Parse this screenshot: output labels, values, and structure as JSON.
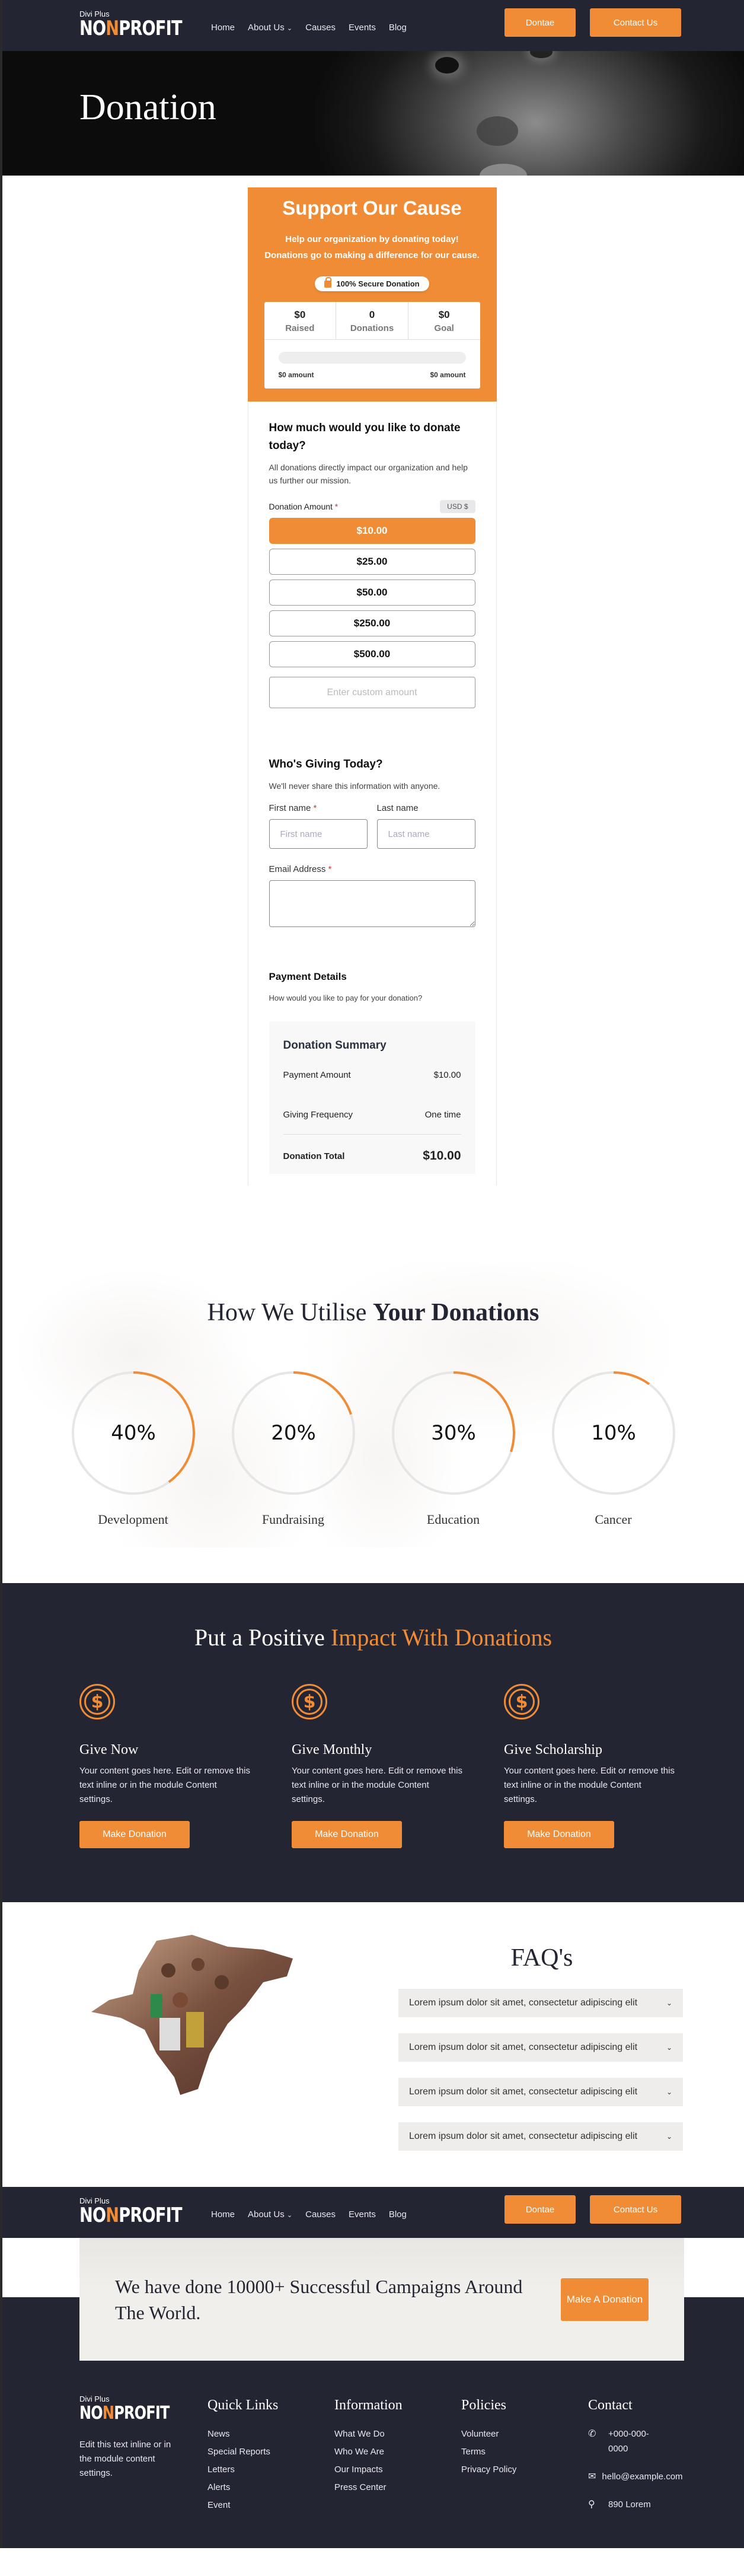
{
  "brand": {
    "sub": "Divi Plus",
    "main_pre": "NO",
    "main_hl": "N",
    "main_post": "PROFIT",
    "accent": "#f08c35",
    "dark": "#232532"
  },
  "nav": {
    "items": [
      "Home",
      "About Us",
      "Causes",
      "Events",
      "Blog"
    ],
    "dropdown_icon": "chevron-down-icon",
    "donate_label": "Dontae",
    "contact_label": "Contact Us"
  },
  "hero": {
    "title": "Donation"
  },
  "cause": {
    "title": "Support Our Cause",
    "text": "Help our organization by donating today! Donations go to making a difference for our cause.",
    "secure_label": "100% Secure Donation",
    "stats": [
      {
        "value": "$0",
        "label": "Raised"
      },
      {
        "value": "0",
        "label": "Donations"
      },
      {
        "value": "$0",
        "label": "Goal"
      }
    ],
    "progress_percent": 0,
    "progress_left": "$0 amount",
    "progress_right": "$0 amount"
  },
  "amount_section": {
    "title": "How much would you like to donate today?",
    "desc": "All donations directly impact our organization and help us further our mission.",
    "label": "Donation Amount",
    "required": "*",
    "currency": "USD  $",
    "options": [
      "$10.00",
      "$25.00",
      "$50.00",
      "$250.00",
      "$500.00"
    ],
    "selected_index": 0,
    "custom_placeholder": "Enter custom amount"
  },
  "giver_section": {
    "title": "Who's Giving Today?",
    "desc": "We'll never share this information with anyone.",
    "first_label": "First name",
    "first_placeholder": "First name",
    "last_label": "Last name",
    "last_placeholder": "Last name",
    "email_label": "Email Address",
    "required": "*"
  },
  "payment_section": {
    "title": "Payment Details",
    "desc": "How would you like to pay for your donation?",
    "summary_title": "Donation Summary",
    "rows": [
      {
        "label": "Payment Amount",
        "value": "$10.00"
      },
      {
        "label": "Giving Frequency",
        "value": "One time"
      }
    ],
    "total_label": "Donation Total",
    "total_value": "$10.00"
  },
  "utilise": {
    "title_normal": "How We Utilise ",
    "title_bold": "Your Donations",
    "items": [
      {
        "percent": 40,
        "text": "40%",
        "label": "Development"
      },
      {
        "percent": 20,
        "text": "20%",
        "label": "Fundraising"
      },
      {
        "percent": 30,
        "text": "30%",
        "label": "Education"
      },
      {
        "percent": 10,
        "text": "10%",
        "label": "Cancer"
      }
    ]
  },
  "impact": {
    "title_normal": "Put a Positive ",
    "title_highlight": "Impact With Donations",
    "items": [
      {
        "icon": "dollar-coin-icon",
        "title": "Give Now",
        "text": "Your content goes here. Edit or remove this text inline or in the module Content settings.",
        "button": "Make Donation"
      },
      {
        "icon": "dollar-coin-icon",
        "title": "Give Monthly",
        "text": "Your content goes here. Edit or remove this text inline or in the module Content settings.",
        "button": "Make Donation"
      },
      {
        "icon": "dollar-coin-icon",
        "title": "Give Scholarship",
        "text": "Your content goes here. Edit or remove this text inline or in the module Content settings.",
        "button": "Make Donation"
      }
    ]
  },
  "faq": {
    "title": "FAQ's",
    "items": [
      "Lorem ipsum dolor sit amet, consectetur adipiscing elit",
      "Lorem ipsum dolor sit amet, consectetur adipiscing elit",
      "Lorem ipsum dolor sit amet, consectetur adipiscing elit",
      "Lorem ipsum dolor sit amet, consectetur adipiscing elit"
    ]
  },
  "cta": {
    "text": "We have done 10000+ Successful Campaigns Around The World.",
    "button": "Make A Donation"
  },
  "footer": {
    "desc": "Edit this text inline or in the module content settings.",
    "columns": [
      {
        "title": "Quick Links",
        "links": [
          "News",
          "Special Reports",
          "Letters",
          "Alerts",
          "Event"
        ]
      },
      {
        "title": "Information",
        "links": [
          "What We Do",
          "Who We Are",
          "Our Impacts",
          "Press Center"
        ]
      },
      {
        "title": "Policies",
        "links": [
          "Volunteer",
          "Terms",
          "Privacy Policy"
        ]
      }
    ],
    "contact": {
      "title": "Contact",
      "phone": "+000-000-0000",
      "email": "hello@example.com",
      "address": "890 Lorem"
    }
  }
}
